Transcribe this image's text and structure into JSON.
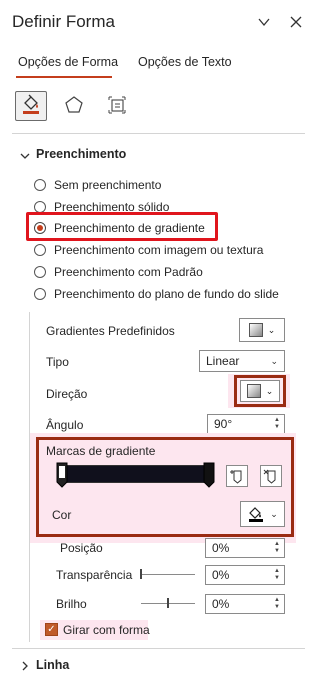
{
  "pane": {
    "title": "Definir Forma"
  },
  "tabs": [
    {
      "label": "Opções de Forma",
      "active": true
    },
    {
      "label": "Opções de Texto",
      "active": false
    }
  ],
  "icons": {
    "fill_line": "paint-bucket-icon",
    "effects": "pentagon-icon",
    "size_props": "size-properties-icon"
  },
  "fill_section": {
    "title": "Preenchimento",
    "options": [
      {
        "label": "Sem preenchimento",
        "selected": false
      },
      {
        "label": "Preenchimento sólido",
        "selected": false
      },
      {
        "label": "Preenchimento de gradiente",
        "selected": true
      },
      {
        "label": "Preenchimento com imagem ou textura",
        "selected": false
      },
      {
        "label": "Preenchimento com Padrão",
        "selected": false
      },
      {
        "label": "Preenchimento do plano de fundo do slide",
        "selected": false
      }
    ],
    "preset_label": "Gradientes Predefinidos",
    "type_label": "Tipo",
    "type_value": "Linear",
    "direction_label": "Direção",
    "angle_label": "Ângulo",
    "angle_value": "90°",
    "stops_label": "Marcas de gradiente",
    "color_label": "Cor",
    "position_label": "Posição",
    "position_value": "0%",
    "transparency_label": "Transparência",
    "transparency_value": "0%",
    "brightness_label": "Brilho",
    "brightness_value": "0%",
    "rotate_label": "Girar com forma",
    "rotate_checked": true
  },
  "line_section": {
    "title": "Linha"
  },
  "colors": {
    "accent": "#c43e1c",
    "highlight_red": "#e0151d",
    "highlight_dark_red": "#9a2b12",
    "highlight_pink": "#fde6ef"
  }
}
